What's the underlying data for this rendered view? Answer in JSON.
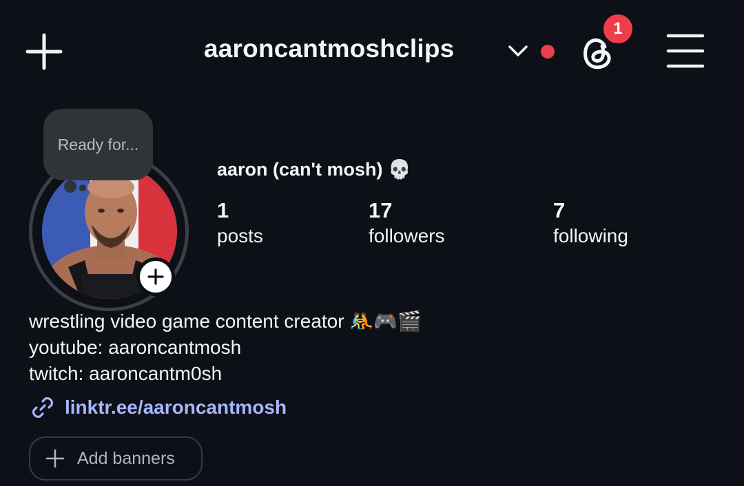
{
  "header": {
    "username": "aaroncantmoshclips",
    "threads_badge_count": "1",
    "icons": {
      "create": "plus-icon",
      "account_switcher": "chevron-down-icon",
      "threads": "threads-icon",
      "menu": "hamburger-menu-icon"
    },
    "colors": {
      "notification_dot": "#ed3c4c",
      "badge": "#ef3d49"
    }
  },
  "profile": {
    "note": "Ready for...",
    "display_name": "aaron (can't mosh) 💀",
    "avatar_alt": "profile photo",
    "stats": [
      {
        "value": "1",
        "label": "posts"
      },
      {
        "value": "17",
        "label": "followers"
      },
      {
        "value": "7",
        "label": "following"
      }
    ],
    "bio_lines": [
      "wrestling video game content creator 🤼🎮🎬",
      "youtube: aaroncantmosh",
      "twitch: aaroncantm0sh"
    ],
    "link": "linktr.ee/aaroncantmosh",
    "add_banners_label": "Add banners"
  },
  "colors": {
    "background": "#0d1017",
    "link": "#a7b7ff",
    "text": "#f3f5f7"
  }
}
